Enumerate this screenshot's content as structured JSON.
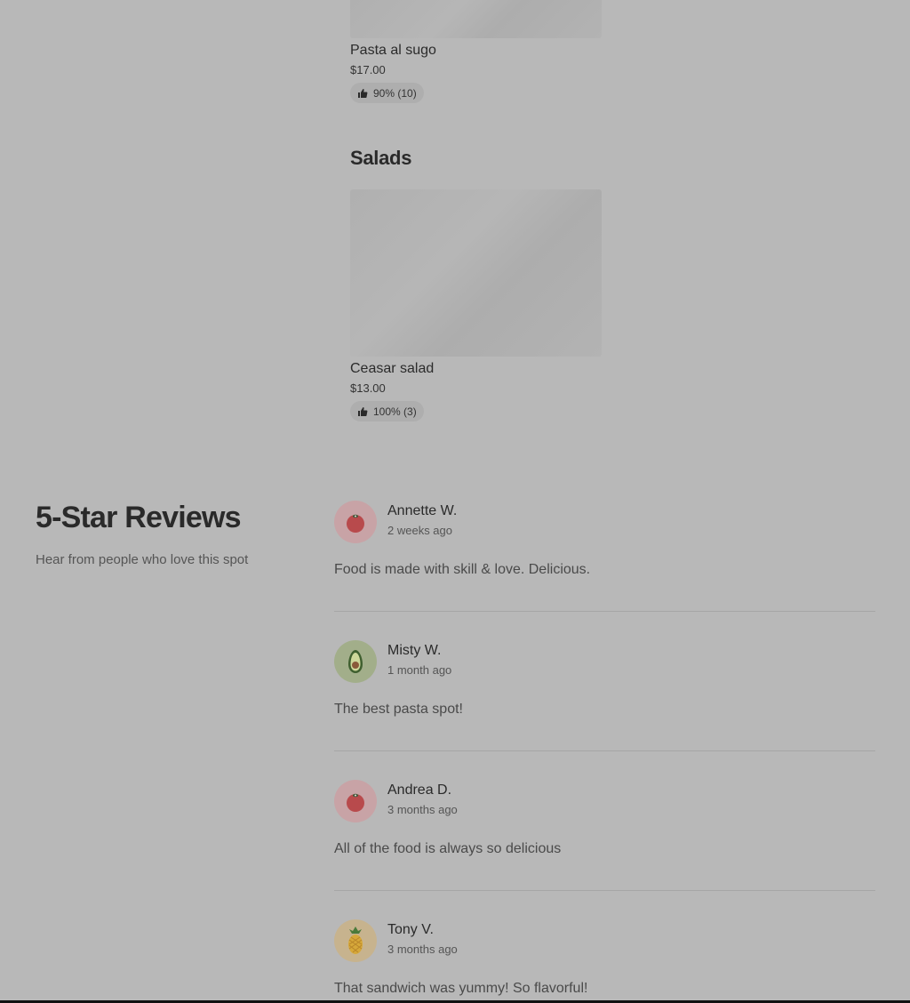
{
  "menu": {
    "items": [
      {
        "name": "Pasta al sugo",
        "price": "$17.00",
        "rating": "90% (10)"
      },
      {
        "name": "Ceasar salad",
        "price": "$13.00",
        "rating": "100% (3)"
      }
    ],
    "sections": [
      {
        "heading": "Salads"
      }
    ]
  },
  "reviews": {
    "title": "5-Star Reviews",
    "subtitle": "Hear from people who love this spot",
    "list": [
      {
        "name": "Annette W.",
        "date": "2 weeks ago",
        "text": "Food is made with skill & love. Delicious.",
        "avatar_icon": "tomato-icon"
      },
      {
        "name": "Misty W.",
        "date": "1 month ago",
        "text": "The best pasta spot!",
        "avatar_icon": "avocado-icon"
      },
      {
        "name": "Andrea D.",
        "date": "3 months ago",
        "text": "All of the food is always so delicious",
        "avatar_icon": "tomato-icon"
      },
      {
        "name": "Tony V.",
        "date": "3 months ago",
        "text": "That sandwich was yummy! So flavorful!",
        "avatar_icon": "pineapple-icon"
      }
    ]
  },
  "colors": {
    "background": "#b8b8b8",
    "text": "#2a2a2a",
    "pill": "#aeaeae"
  }
}
